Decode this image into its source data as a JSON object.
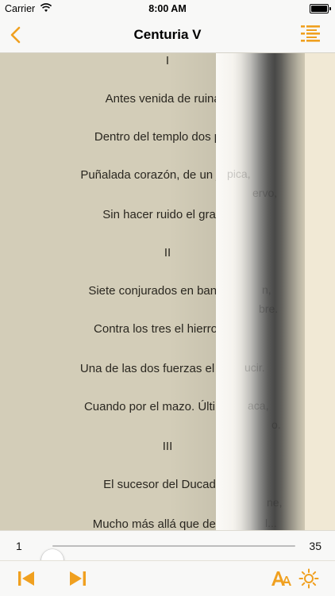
{
  "status_bar": {
    "carrier": "Carrier",
    "time": "8:00 AM"
  },
  "nav": {
    "title": "Centuria V",
    "back_icon": "chevron-left-icon",
    "toc_icon": "list-icon"
  },
  "colors": {
    "accent": "#f0a01f"
  },
  "page_text": [
    "I",
    "Antes venida de ruina c",
    "Dentro del templo dos parla",
    "Puñalada corazón, de un jinete e",
    "Sin hacer ruido el gran e",
    "II",
    "Siete conjurados en banquete",
    "Contra los tres el hierro fuer",
    "Una de las dos fuerzas el grande",
    "Cuando por el mazo. Último del",
    "III",
    "El sucesor del Ducado v",
    "Mucho más allá que del mar"
  ],
  "curl_fragments": [
    "pica,",
    "ervo,",
    "n,",
    "bre.",
    "ucir.",
    "aca,",
    "o.",
    "ne,",
    "l..."
  ],
  "slider": {
    "min_label": "1",
    "max_label": "35",
    "value": 1,
    "min": 1,
    "max": 35
  },
  "toolbar": {
    "prev_icon": "skip-back-icon",
    "next_icon": "skip-forward-icon",
    "font_icon": "font-size-icon",
    "brightness_icon": "brightness-icon"
  }
}
